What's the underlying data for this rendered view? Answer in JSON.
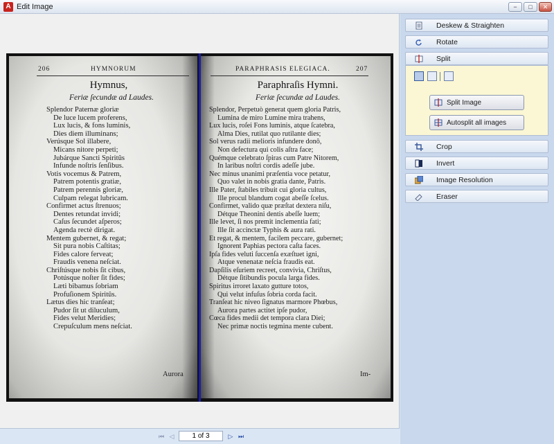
{
  "window": {
    "title": "Edit Image",
    "app_icon": "A",
    "min_glyph": "−",
    "max_glyph": "□",
    "close_glyph": "✕"
  },
  "scan": {
    "left_page": {
      "page_number": "206",
      "running_head": "HYMNORUM",
      "title": "Hymnus,",
      "subtitle": "Feriæ ſecundæ ad Laudes.",
      "lines": [
        "Splendor Paternæ gloriæ",
        "De luce lucem proferens,",
        "Lux lucis, & fons luminis,",
        "Dies diem illuminans;",
        "Verúsque Sol illabere,",
        "Micans nitore perpeti;",
        "Jubárque Sancti Spiritûs",
        "Infunde noſtris ſenſibus.",
        "Votis vocemus & Patrem,",
        "Patrem potentis gratiæ,",
        "Patrem perennis gloriæ,",
        "Culpam relegat lubricam.",
        "Confirmet actus ſtrenuos;",
        "Dentes retundat invidi;",
        "Caſus ſecundet aſperos;",
        "Agenda rectè dirigat.",
        "Mentem gubernet, & regat;",
        "Sit pura nobis Caſtitas;",
        "Fides calore ferveat;",
        "Fraudis venena neſciat.",
        "Chriſtúsque nobis ſit cibus,",
        "Potúsque noſter ſit fides;",
        "Læti bibamus ſobriam",
        "Profuſionem Spiritûs.",
        "Lætus dies hic tranſeat;",
        "Pudor ſit ut diluculum,",
        "Fides velut Meridies;",
        "Crepuſculum mens neſciat."
      ],
      "catchword": "Aurora"
    },
    "right_page": {
      "page_number": "207",
      "running_head": "PARAPHRASIS ELEGIACA.",
      "title": "Paraphraſis Hymni.",
      "subtitle": "Feriæ ſecundæ ad Laudes.",
      "lines": [
        "Splendor, Perpetuò generat quem gloria Patris,",
        "Lumina de miro Lumine mira trahens,",
        "Lux lucis, roſei Fons luminis, atque ſcatebra,",
        "Alma Dies, rutilat quo rutilante dies;",
        "Sol verus radii melioris infundere donô,",
        "Non defectura qui colis aſtra face;",
        "Quémque celebrato ſpiras cum Patre Nitorem,",
        "In laribus noſtri cordis adeſſe jube.",
        "Nec minus unanimi præſentia voce petatur,",
        "Quo valet in nobis gratia dante, Patris.",
        "Ille Pater, ſtabiles tribuit cui gloria cultus,",
        "Ille procul blandum cogat abeſſe ſcelus.",
        "Confirmet, valido quæ præſtat dextera niſu,",
        "Détque Theonini dentis abeſſe luem;",
        "Ille levet, ſi nos premit inclementia fati;",
        "Ille ſit accinctæ Typhis & aura rati.",
        "Et regat, & mentem, facilem peccare, gubernet;",
        "Ignorent Paphias pectora caſta faces.",
        "Ipſa fides veluti ſuccenſa exæſtuet igni,",
        "Atque venenatæ neſcia fraudis eat.",
        "Dapſilis eſuriem recreet, convivia, Chriſtus,",
        "Détque ſitibundis pocula larga fides.",
        "Spiritus irroret laxato gutture totos,",
        "Qui velut infuſus ſobria corda facit.",
        "Tranſeat hic niveo ſignatus marmore Phœbus,",
        "Aurora partes actitet ipſe pudor,",
        "Cœca fides medii det tempora clara Diei;",
        "Nec primæ noctis tegmina mente cubent."
      ],
      "catchword": "Im-"
    }
  },
  "pager": {
    "first": "⏮",
    "prev": "◁",
    "current": "1 of 3",
    "next": "▷",
    "last": "⏭"
  },
  "panel": {
    "tools": [
      {
        "label": "Deskew & Straighten",
        "icon": "deskew-icon"
      },
      {
        "label": "Rotate",
        "icon": "rotate-icon"
      },
      {
        "label": "Split",
        "icon": "split-icon"
      },
      {
        "label": "Crop",
        "icon": "crop-icon"
      },
      {
        "label": "Invert",
        "icon": "invert-icon"
      },
      {
        "label": "Image Resolution",
        "icon": "image-resolution-icon"
      },
      {
        "label": "Eraser",
        "icon": "eraser-icon"
      }
    ],
    "split": {
      "modes": [
        "split-vertical-icon",
        "split-horizontal-icon",
        "split-single-icon"
      ],
      "split_image_label": "Split Image",
      "autosplit_label": "Autosplit all images"
    }
  },
  "colors": {
    "split_line": "#1d1ea8",
    "panel_bg": "#c9d8ec",
    "split_panel_bg": "#fbf7d4"
  }
}
